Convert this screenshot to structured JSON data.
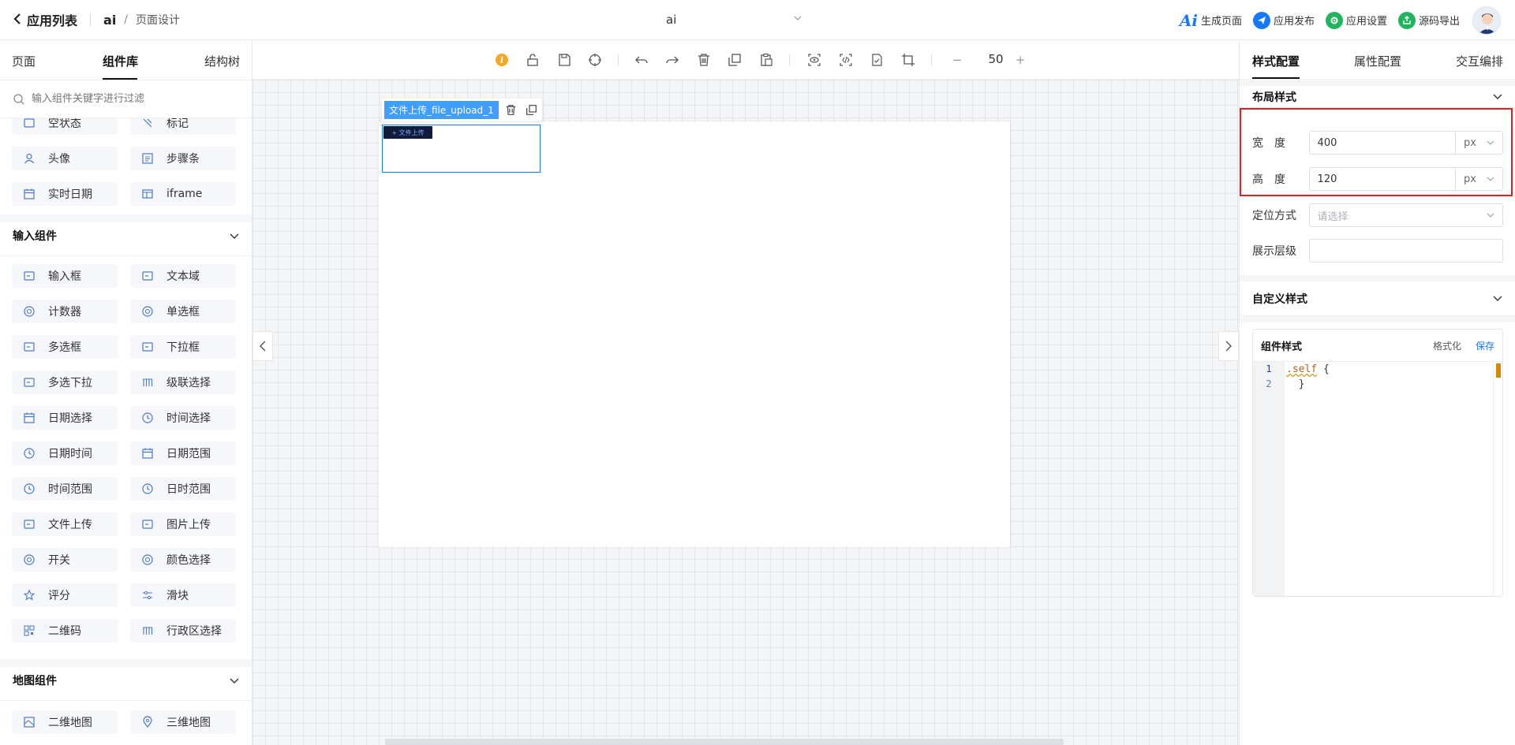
{
  "header": {
    "back_label": "应用列表",
    "app_name": "ai",
    "breadcrumb_sep": "/",
    "breadcrumb_page": "页面设计",
    "page_select": "ai",
    "actions": [
      {
        "label": "生成页面",
        "icon": "ai-icon",
        "color": "#1677ff"
      },
      {
        "label": "应用发布",
        "icon": "send-icon",
        "color": "#1677ff"
      },
      {
        "label": "应用设置",
        "icon": "settings-gear-icon",
        "color": "#22b35e"
      },
      {
        "label": "源码导出",
        "icon": "export-icon",
        "color": "#22b35e"
      }
    ]
  },
  "left_panel": {
    "tabs": [
      "页面",
      "组件库",
      "结构树"
    ],
    "active_tab": "组件库",
    "search_placeholder": "输入组件关键字进行过滤",
    "partial_row": [
      "空状态",
      "标记"
    ],
    "basic_items": [
      [
        "头像",
        "步骤条"
      ],
      [
        "实时日期",
        "iframe"
      ]
    ],
    "input_group_title": "输入组件",
    "input_items": [
      [
        "输入框",
        "文本域"
      ],
      [
        "计数器",
        "单选框"
      ],
      [
        "多选框",
        "下拉框"
      ],
      [
        "多选下拉",
        "级联选择"
      ],
      [
        "日期选择",
        "时间选择"
      ],
      [
        "日期时间",
        "日期范围"
      ],
      [
        "时间范围",
        "日时范围"
      ],
      [
        "文件上传",
        "图片上传"
      ],
      [
        "开关",
        "颜色选择"
      ],
      [
        "评分",
        "滑块"
      ],
      [
        "二维码",
        "行政区选择"
      ]
    ],
    "map_group_title": "地图组件",
    "map_items": [
      [
        "二维地图",
        "三维地图"
      ]
    ]
  },
  "toolbar": {
    "zoom_value": "50",
    "zoom_minus": "−",
    "zoom_plus": "+"
  },
  "canvas": {
    "selected_label": "文件上传_file_upload_1",
    "upload_button_text": "+ 文件上传"
  },
  "right_panel": {
    "tabs": [
      "样式配置",
      "属性配置",
      "交互编排"
    ],
    "active_tab": "样式配置",
    "layout_section": "布局样式",
    "width_label": "宽　度",
    "width_value": "400",
    "width_unit": "px",
    "height_label": "高　度",
    "height_value": "120",
    "height_unit": "px",
    "position_label": "定位方式",
    "position_placeholder": "请选择",
    "zindex_label": "展示层级",
    "zindex_value": "",
    "custom_section": "自定义样式",
    "code_title": "组件样式",
    "format_label": "格式化",
    "save_label": "保存",
    "code_lines": [
      ".self {",
      "  }"
    ],
    "line_numbers": [
      "1",
      "2"
    ]
  },
  "colors": {
    "accent": "#1677ff",
    "selection_tag": "#409eff",
    "highlight_border": "#e02020"
  }
}
